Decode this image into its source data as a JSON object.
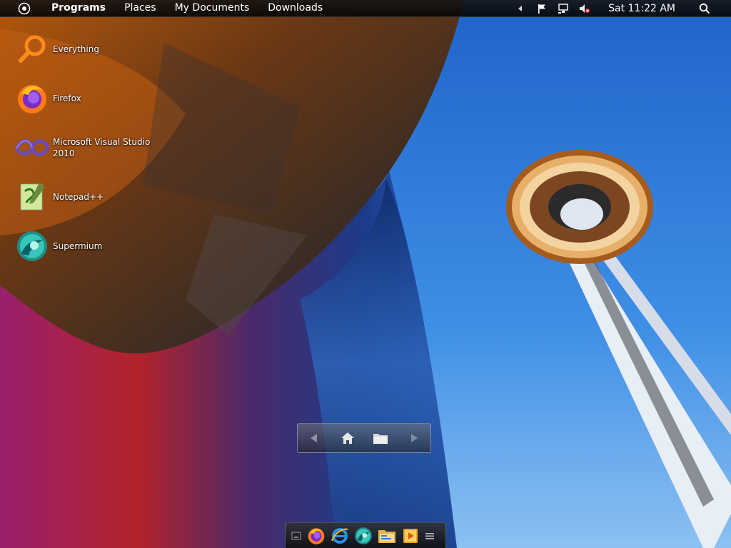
{
  "topbar": {
    "menu": [
      "Programs",
      "Places",
      "My Documents",
      "Downloads"
    ],
    "clock": "Sat 11:22 AM",
    "tray_icons": [
      "chevron-left-icon",
      "flag-icon",
      "network-icon",
      "volume-muted-icon"
    ]
  },
  "desktop_icons": [
    {
      "label": "Everything",
      "icon": "everything-search-icon"
    },
    {
      "label": "Firefox",
      "icon": "firefox-icon"
    },
    {
      "label": "Microsoft Visual Studio 2010",
      "icon": "visual-studio-icon"
    },
    {
      "label": "Notepad++",
      "icon": "notepadpp-icon"
    },
    {
      "label": "Supermium",
      "icon": "supermium-icon"
    }
  ],
  "nav_widget": {
    "buttons": [
      "back-arrow-icon",
      "home-icon",
      "folder-icon",
      "forward-arrow-icon"
    ]
  },
  "dock": {
    "items": [
      "show-desktop-icon",
      "firefox-icon",
      "internet-explorer-icon",
      "supermium-icon",
      "file-explorer-icon",
      "media-player-icon",
      "menu-icon"
    ]
  },
  "colors": {
    "sky": "#3b8ae6",
    "accent_orange": "#ff8a1c",
    "topbar": "#0d0d0d"
  }
}
